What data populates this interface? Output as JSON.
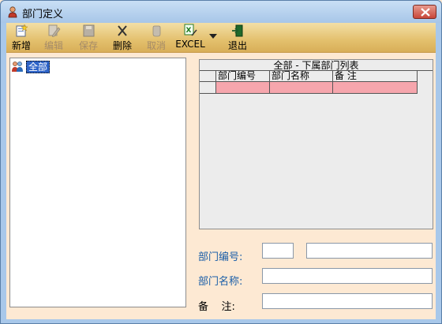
{
  "window": {
    "title": "部门定义",
    "close_label": "×"
  },
  "toolbar": {
    "buttons": [
      {
        "id": "add",
        "label": "新增",
        "enabled": true,
        "icon": "new-document-icon"
      },
      {
        "id": "edit",
        "label": "编辑",
        "enabled": false,
        "icon": "edit-icon"
      },
      {
        "id": "save",
        "label": "保存",
        "enabled": false,
        "icon": "save-icon"
      },
      {
        "id": "delete",
        "label": "删除",
        "enabled": true,
        "icon": "delete-x-icon"
      },
      {
        "id": "cancel",
        "label": "取消",
        "enabled": false,
        "icon": "cancel-icon"
      },
      {
        "id": "excel",
        "label": "EXCEL",
        "enabled": true,
        "icon": "excel-icon"
      },
      {
        "id": "exit",
        "label": "退出",
        "enabled": true,
        "icon": "exit-door-icon"
      }
    ]
  },
  "tree": {
    "root_label": "全部",
    "root_icon": "people-group-icon"
  },
  "grid": {
    "caption": "全部 - 下属部门列表",
    "columns": [
      "部门编号",
      "部门名称",
      "备    注"
    ],
    "rows": [
      [
        "",
        "",
        ""
      ]
    ],
    "row_color": "#f6a6ad"
  },
  "form": {
    "dept_code_label": "部门编号:",
    "dept_code_value": "",
    "dept_code_extra_value": "",
    "dept_name_label": "部门名称:",
    "dept_name_value": "",
    "remark_label": "备    注:",
    "remark_value": ""
  },
  "colors": {
    "window_frame": "#a8c8ea",
    "client_bg": "#fde9d3",
    "toolbar_bg": "#e3c06d",
    "label_blue": "#1a5ea8",
    "selection": "#2f64c8"
  }
}
